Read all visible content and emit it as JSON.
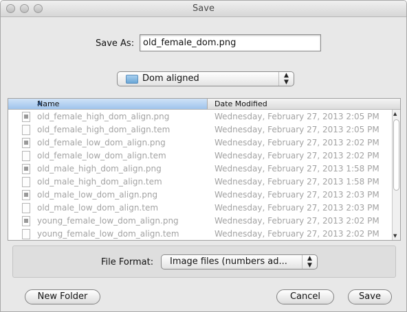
{
  "window": {
    "title": "Save"
  },
  "save_as": {
    "label": "Save As:",
    "value": "old_female_dom.png"
  },
  "folder": {
    "selected": "Dom aligned",
    "icon": "folder-icon"
  },
  "file_list": {
    "columns": [
      "Name",
      "Date Modified"
    ],
    "sort_column": "Name",
    "sort_direction": "ascending",
    "rows": [
      {
        "name": "old_female_high_dom_align.png",
        "date": "Wednesday, February 27, 2013 2:05 PM",
        "type": "png"
      },
      {
        "name": "old_female_high_dom_align.tem",
        "date": "Wednesday, February 27, 2013 2:05 PM",
        "type": "tem"
      },
      {
        "name": "old_female_low_dom_align.png",
        "date": "Wednesday, February 27, 2013 2:02 PM",
        "type": "png"
      },
      {
        "name": "old_female_low_dom_align.tem",
        "date": "Wednesday, February 27, 2013 2:02 PM",
        "type": "tem"
      },
      {
        "name": "old_male_high_dom_align.png",
        "date": "Wednesday, February 27, 2013 1:58 PM",
        "type": "png"
      },
      {
        "name": "old_male_high_dom_align.tem",
        "date": "Wednesday, February 27, 2013 1:58 PM",
        "type": "tem"
      },
      {
        "name": "old_male_low_dom_align.png",
        "date": "Wednesday, February 27, 2013 2:03 PM",
        "type": "png"
      },
      {
        "name": "old_male_low_dom_align.tem",
        "date": "Wednesday, February 27, 2013 2:03 PM",
        "type": "tem"
      },
      {
        "name": "young_female_low_dom_align.png",
        "date": "Wednesday, February 27, 2013 2:02 PM",
        "type": "png"
      },
      {
        "name": "young_female_low_dom_align.tem",
        "date": "Wednesday, February 27, 2013 2:02 PM",
        "type": "tem"
      }
    ]
  },
  "file_format": {
    "label": "File Format:",
    "selected": "Image files (numbers ad..."
  },
  "buttons": {
    "new_folder": "New Folder",
    "cancel": "Cancel",
    "save": "Save"
  },
  "colors": {
    "window_bg": "#e8e8e8",
    "header_selected": "#9fc4ec",
    "disabled_text": "#a2a2a2"
  }
}
